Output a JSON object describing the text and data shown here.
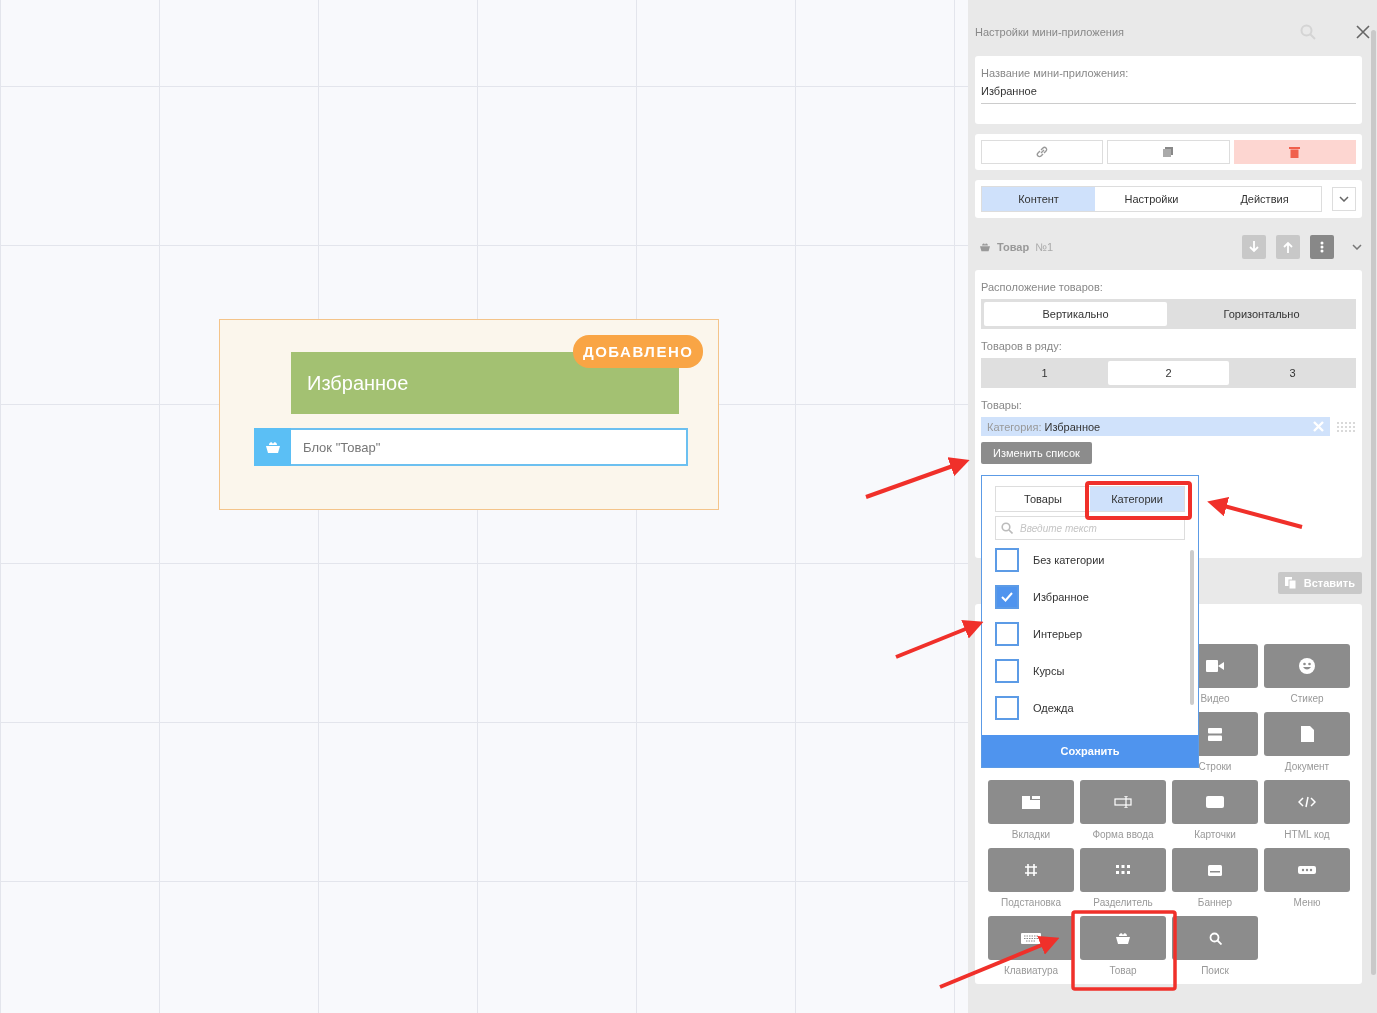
{
  "canvas": {
    "header": "Избранное",
    "badge": "ДОБАВЛЕНО",
    "block_label": "Блок \"Товар\""
  },
  "panel": {
    "title": "Настройки мини-приложения",
    "name_field": {
      "label": "Название мини-приложения:",
      "value": "Избранное"
    },
    "tabs": [
      {
        "label": "Контент",
        "selected": true
      },
      {
        "label": "Настройки",
        "selected": false
      },
      {
        "label": "Действия",
        "selected": false
      }
    ],
    "block_header": {
      "title": "Товар",
      "number": "№1"
    },
    "layout": {
      "label": "Расположение товаров:",
      "options": [
        {
          "label": "Вертикально",
          "selected": true
        },
        {
          "label": "Горизонтально",
          "selected": false
        }
      ]
    },
    "per_row": {
      "label": "Товаров в ряду:",
      "options": [
        {
          "label": "1",
          "selected": false
        },
        {
          "label": "2",
          "selected": true
        },
        {
          "label": "3",
          "selected": false
        }
      ]
    },
    "products": {
      "label": "Товары:",
      "chip_prefix": "Категория:",
      "chip_value": "Избранное",
      "change_button": "Изменить список"
    },
    "paste_button": "Вставить",
    "block_rows": [
      [
        {
          "kind": "video",
          "label": "Видео"
        },
        {
          "kind": "sticker",
          "label": "Стикер"
        }
      ],
      [
        {
          "kind": "rows",
          "label": "Строки"
        },
        {
          "kind": "document",
          "label": "Документ"
        }
      ],
      [
        {
          "kind": "tabs",
          "label": "Вкладки"
        },
        {
          "kind": "form",
          "label": "Форма ввода"
        },
        {
          "kind": "cards",
          "label": "Карточки"
        },
        {
          "kind": "html",
          "label": "HTML код"
        }
      ],
      [
        {
          "kind": "substitution",
          "label": "Подстановка"
        },
        {
          "kind": "divider",
          "label": "Разделитель"
        },
        {
          "kind": "banner",
          "label": "Баннер"
        },
        {
          "kind": "menu",
          "label": "Меню"
        }
      ],
      [
        {
          "kind": "keyboard",
          "label": "Клавиатура"
        },
        {
          "kind": "product",
          "label": "Товар"
        },
        {
          "kind": "search",
          "label": "Поиск"
        }
      ]
    ]
  },
  "dropdown": {
    "tabs": [
      {
        "label": "Товары",
        "selected": false
      },
      {
        "label": "Категории",
        "selected": true
      }
    ],
    "search_placeholder": "Введите текст",
    "items": [
      {
        "label": "Без категории",
        "checked": false
      },
      {
        "label": "Избранное",
        "checked": true
      },
      {
        "label": "Интерьер",
        "checked": false
      },
      {
        "label": "Курсы",
        "checked": false
      },
      {
        "label": "Одежда",
        "checked": false
      }
    ],
    "save_button": "Сохранить"
  }
}
